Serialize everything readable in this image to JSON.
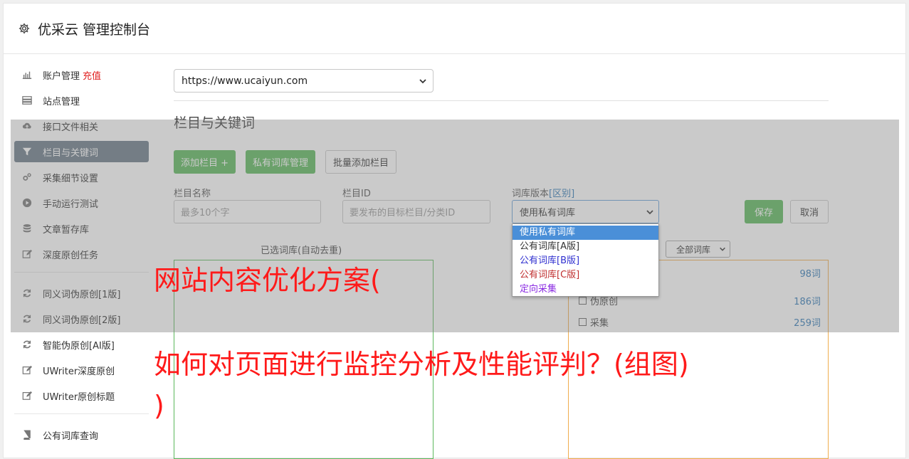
{
  "header": {
    "title": "优采云 管理控制台"
  },
  "sidebar": {
    "group1": [
      {
        "label": "账户管理",
        "extra": "充值",
        "icon": "bar-chart-icon"
      },
      {
        "label": "站点管理",
        "icon": "server-icon"
      },
      {
        "label": "接口文件相关",
        "icon": "cloud-upload-icon"
      },
      {
        "label": "栏目与关键词",
        "icon": "filter-icon"
      },
      {
        "label": "采集细节设置",
        "icon": "gears-icon"
      },
      {
        "label": "手动运行测试",
        "icon": "play-icon"
      },
      {
        "label": "文章暂存库",
        "icon": "database-icon"
      },
      {
        "label": "深度原创任务",
        "icon": "edit-icon"
      }
    ],
    "group2": [
      {
        "label": "同义词伪原创[1版]",
        "icon": "refresh-icon"
      },
      {
        "label": "同义词伪原创[2版]",
        "icon": "refresh-icon"
      },
      {
        "label": "智能伪原创[AI版]",
        "icon": "refresh-icon"
      },
      {
        "label": "UWriter深度原创",
        "icon": "edit-icon"
      },
      {
        "label": "UWriter原创标题",
        "icon": "edit-icon"
      }
    ],
    "group3": [
      {
        "label": "公有词库查询",
        "icon": "book-icon"
      }
    ]
  },
  "main": {
    "site_select": "https://www.ucaiyun.com",
    "section_title": "栏目与关键词",
    "buttons": {
      "add_column": "添加栏目 +",
      "private_lib": "私有词库管理",
      "batch_add": "批量添加栏目"
    },
    "form": {
      "name_label": "栏目名称",
      "name_placeholder": "最多10个字",
      "id_label": "栏目ID",
      "id_placeholder": "要发布的目标栏目/分类ID",
      "lib_label": "词库版本",
      "lib_label_link": "[区别]",
      "lib_value": "使用私有词库",
      "save": "保存",
      "cancel": "取消"
    },
    "selected_title": "已选词库(自动去重)",
    "all_lib_select": "全部词库",
    "lib_rows": [
      {
        "label": "",
        "count": "98词"
      },
      {
        "label": "伪原创",
        "count": "186词"
      },
      {
        "label": "采集",
        "count": "259词"
      }
    ],
    "dropdown_options": [
      {
        "label": "使用私有词库",
        "color": "#ffffff"
      },
      {
        "label": "公有词库[A版]",
        "color": "#333333"
      },
      {
        "label": "公有词库[B版]",
        "color": "#3030d0"
      },
      {
        "label": "公有词库[C版]",
        "color": "#c03030"
      },
      {
        "label": "定向采集",
        "color": "#8a2be2"
      }
    ]
  },
  "overlay_text": {
    "line1": "网站内容优化方案(",
    "line2": "如何对页面进行监控分析及性能评判？(组图)",
    "line3": ")"
  }
}
